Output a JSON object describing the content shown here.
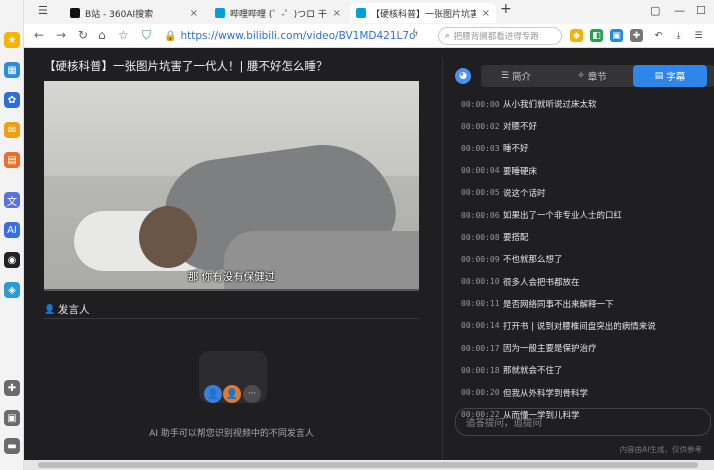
{
  "browser": {
    "tabs": [
      {
        "label": "B站 - 360AI搜索",
        "fav_color": "#111111"
      },
      {
        "label": "哔哩哔哩 (゜-゜)つロ 干杯~-",
        "fav_color": "#00a1d6"
      },
      {
        "label": "【硬核科普】一张图片坑害",
        "fav_color": "#00a1d6"
      }
    ],
    "new_tab": "+",
    "url": "https://www.bilibili.com/video/BV1MD421L7o",
    "search_placeholder": "把腰背搁都看进得专跑"
  },
  "video": {
    "title": "【硬核科普】一张图片坑害了一代人！| 腰不好怎么睡？",
    "subtitle": "那 你有没有保健过",
    "progress": 0.0
  },
  "speaker_section": {
    "label": "发言人",
    "avatar_more": "···",
    "empty_text": "AI 助手可以帮您识别视频中的不同发言人"
  },
  "panel": {
    "tabs": [
      {
        "label": "简介",
        "icon": "☰"
      },
      {
        "label": "章节",
        "icon": "✧"
      },
      {
        "label": "字幕",
        "icon": "▤"
      }
    ],
    "active_tab": "字幕",
    "subtitles": [
      {
        "time": "00:00:00",
        "text": "从小我们就听说过床太软"
      },
      {
        "time": "00:00:02",
        "text": "对腰不好"
      },
      {
        "time": "00:00:03",
        "text": "睡不好"
      },
      {
        "time": "00:00:04",
        "text": "要睡硬床"
      },
      {
        "time": "00:00:05",
        "text": "说这个话时"
      },
      {
        "time": "00:00:06",
        "text": "如果出了一个非专业人士的口红"
      },
      {
        "time": "00:00:08",
        "text": "要搭配"
      },
      {
        "time": "00:00:09",
        "text": "不也就那么想了"
      },
      {
        "time": "00:00:10",
        "text": "很多人会把书都放在"
      },
      {
        "time": "00:00:11",
        "text": "是否网络同事不出来解释一下"
      },
      {
        "time": "00:00:14",
        "text": "打开书 | 说到对腰椎间盘突出的病情来说"
      },
      {
        "time": "00:00:17",
        "text": "因为一般主要是保护治疗"
      },
      {
        "time": "00:00:18",
        "text": "那就就会不住了"
      },
      {
        "time": "00:00:20",
        "text": "但我从外科学到骨科学"
      },
      {
        "time": "00:00:22",
        "text": "从而懂一学到儿科学"
      }
    ],
    "ask_placeholder": "追答提问，追提问",
    "hint": "内容由AI生成，仅供参考"
  },
  "colors": {
    "accent": "#2e86e8",
    "background": "#1f1f22"
  }
}
